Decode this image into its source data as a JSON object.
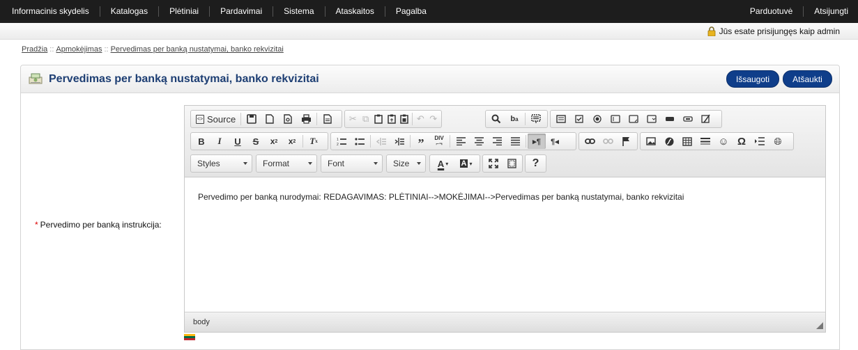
{
  "topnav": {
    "left": [
      "Informacinis skydelis",
      "Katalogas",
      "Plėtiniai",
      "Pardavimai",
      "Sistema",
      "Ataskaitos",
      "Pagalba"
    ],
    "right": [
      "Parduotuvė",
      "Atsijungti"
    ]
  },
  "userbar": {
    "text": "Jūs esate prisijungęs kaip admin"
  },
  "breadcrumb": {
    "items": [
      "Pradžia",
      "Apmokėjimas",
      "Pervedimas per banką nustatymai, banko rekvizitai"
    ],
    "separator": "::"
  },
  "panel": {
    "title": "Pervedimas per banką nustatymai, banko rekvizitai",
    "save_label": "Išsaugoti",
    "cancel_label": "Atšaukti"
  },
  "field": {
    "required_mark": "*",
    "label": "Pervedimo per banką instrukcija:"
  },
  "editor": {
    "source_label": "Source",
    "combos": {
      "styles": "Styles",
      "format": "Format",
      "font": "Font",
      "size": "Size"
    },
    "content": "Pervedimo per banką nurodymai: REDAGAVIMAS: PLĖTINIAI-->MOKĖJIMAI-->Pervedimas per banką nustatymai, banko rekvizitai",
    "status_path": "body"
  },
  "colors": {
    "nav_bg": "#1d1d1d",
    "title": "#1d3e73",
    "button": "#0f3e8a"
  },
  "language_flag": "lithuanian-flag"
}
